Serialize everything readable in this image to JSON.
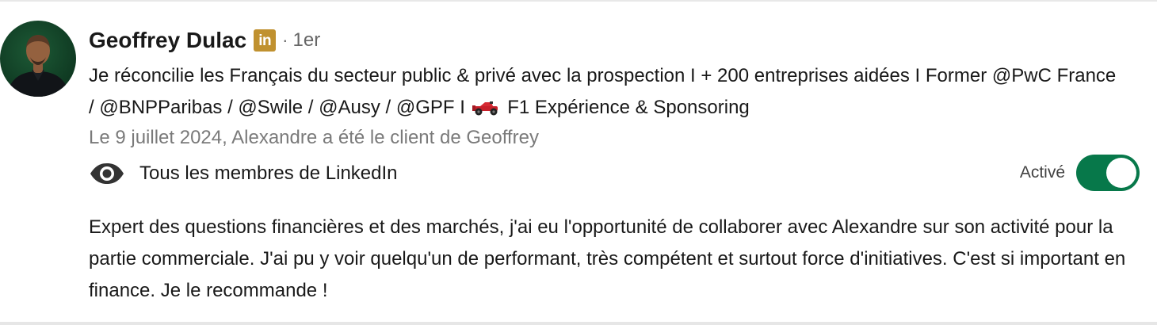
{
  "recommender": {
    "name": "Geoffrey Dulac",
    "badge_icon": "linkedin-premium-icon",
    "badge_text": "in",
    "separator": "·",
    "connection_degree": "1er",
    "headline_part1": "Je réconcilie les Français du secteur public & privé avec la prospection I + 200 entreprises aidées I Former @PwC France / @BNPParibas / @Swile / @Ausy / @GPF I",
    "headline_icon": "race-car-icon",
    "headline_part2": "F1 Expérience & Sponsoring",
    "relationship": "Le 9 juillet 2024, Alexandre a été le client de Geoffrey"
  },
  "visibility": {
    "icon": "eye-icon",
    "label": "Tous les membres de LinkedIn"
  },
  "toggle": {
    "label": "Activé",
    "state": "on",
    "color": "#07784a"
  },
  "recommendation_text": "Expert des questions financières et des marchés, j'ai eu l'opportunité de collaborer avec Alexandre sur son activité pour la partie commerciale. J'ai pu y voir quelqu'un de performant, très compétent et surtout force d'initiatives. C'est si important en finance. Je le recommande !"
}
